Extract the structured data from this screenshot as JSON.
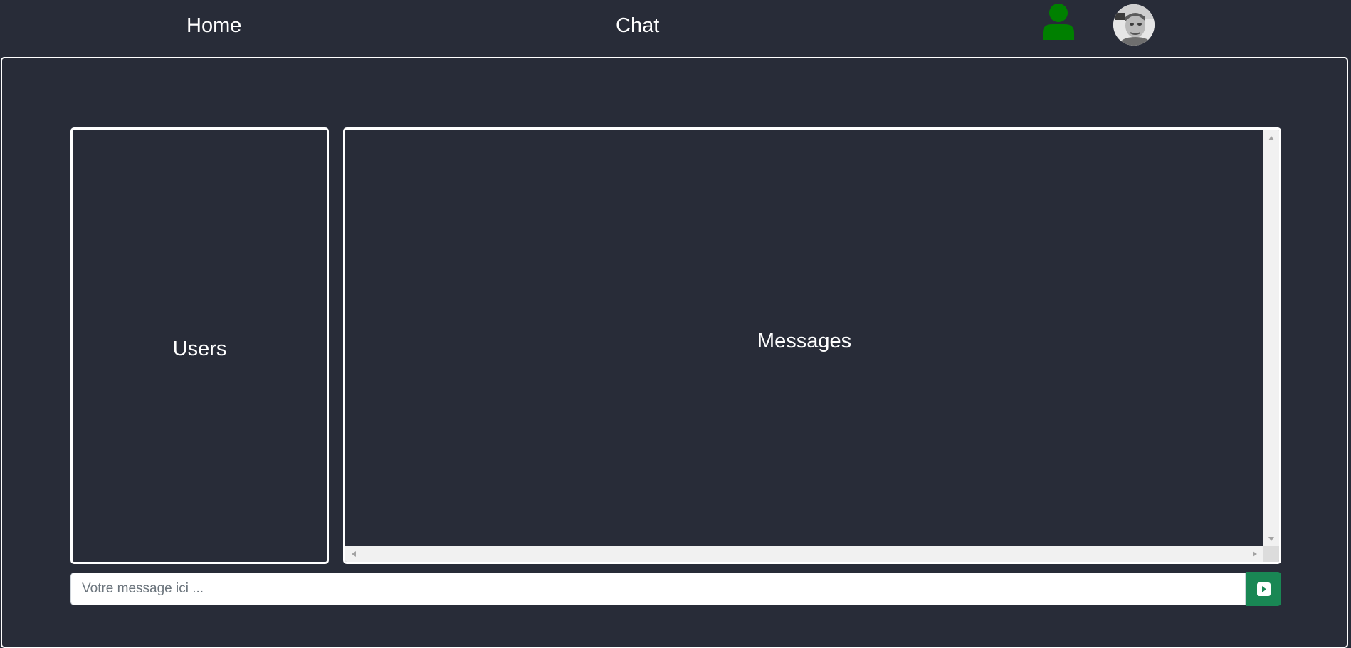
{
  "nav": {
    "home_label": "Home",
    "chat_label": "Chat",
    "status_icon": "user-online-icon",
    "status_color": "#008000",
    "avatar_icon": "user-avatar"
  },
  "main": {
    "users_title": "Users",
    "messages_title": "Messages"
  },
  "composer": {
    "placeholder": "Votre message ici ...",
    "value": "",
    "send_icon": "caret-right-square-icon",
    "send_color": "#198754"
  },
  "colors": {
    "background": "#282c38",
    "border": "#ffffff"
  }
}
